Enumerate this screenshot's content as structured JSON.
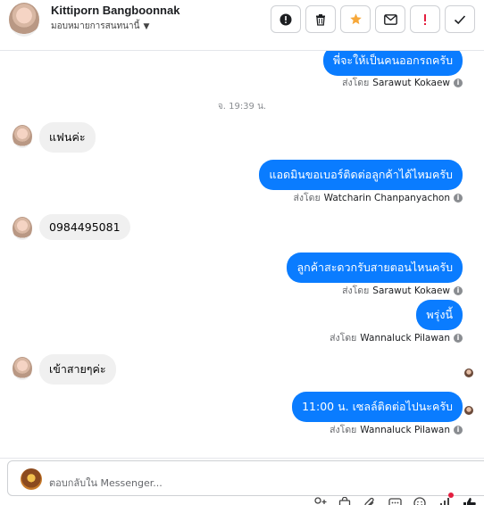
{
  "header": {
    "contact_name": "Kittiporn Bangboonnak",
    "assign_label": "มอบหมายการสนทนานี้"
  },
  "toolbar": [
    {
      "name": "mark-spam-button",
      "icon": "exclamation-circle-icon"
    },
    {
      "name": "delete-button",
      "icon": "trash-icon"
    },
    {
      "name": "star-button",
      "icon": "star-icon",
      "color": "#f7a83a"
    },
    {
      "name": "mark-unread-button",
      "icon": "envelope-icon"
    },
    {
      "name": "flag-button",
      "icon": "exclamation-icon",
      "color": "#e41e3f"
    },
    {
      "name": "done-button",
      "icon": "check-icon"
    }
  ],
  "messages": [
    {
      "dir": "out",
      "text": "พี่จะให้เป็นคนออกรถครับ",
      "sent_prefix": "ส่งโดย",
      "sender": "Sarawut Kokaew"
    },
    {
      "dir": "sep",
      "text": "จ. 19:39 น."
    },
    {
      "dir": "in",
      "text": "แฟนค่ะ"
    },
    {
      "dir": "out",
      "text": "แอดมินขอเบอร์ติดต่อลูกค้าได้ไหมครับ",
      "sent_prefix": "ส่งโดย",
      "sender": "Watcharin Chanpanyachon"
    },
    {
      "dir": "in",
      "text": "0984495081"
    },
    {
      "dir": "out",
      "text": "ลูกค้าสะดวกรับสายตอนไหนครับ",
      "sent_prefix": "ส่งโดย",
      "sender": "Sarawut Kokaew"
    },
    {
      "dir": "out",
      "text": "พรุ่งนี้",
      "sent_prefix": "ส่งโดย",
      "sender": "Wannaluck Pilawan"
    },
    {
      "dir": "in",
      "text": "เข้าสายๆค่ะ"
    },
    {
      "dir": "out",
      "text": "11:00 น. เซลล์ติดต่อไปนะครับ",
      "sent_prefix": "ส่งโดย",
      "sender": "Wannaluck Pilawan"
    }
  ],
  "composer": {
    "placeholder": "ตอบกลับใน Messenger..."
  },
  "colors": {
    "outgoing_bubble": "#0a7cff",
    "incoming_bubble": "#f0f0f0",
    "accent_red": "#e41e3f"
  }
}
